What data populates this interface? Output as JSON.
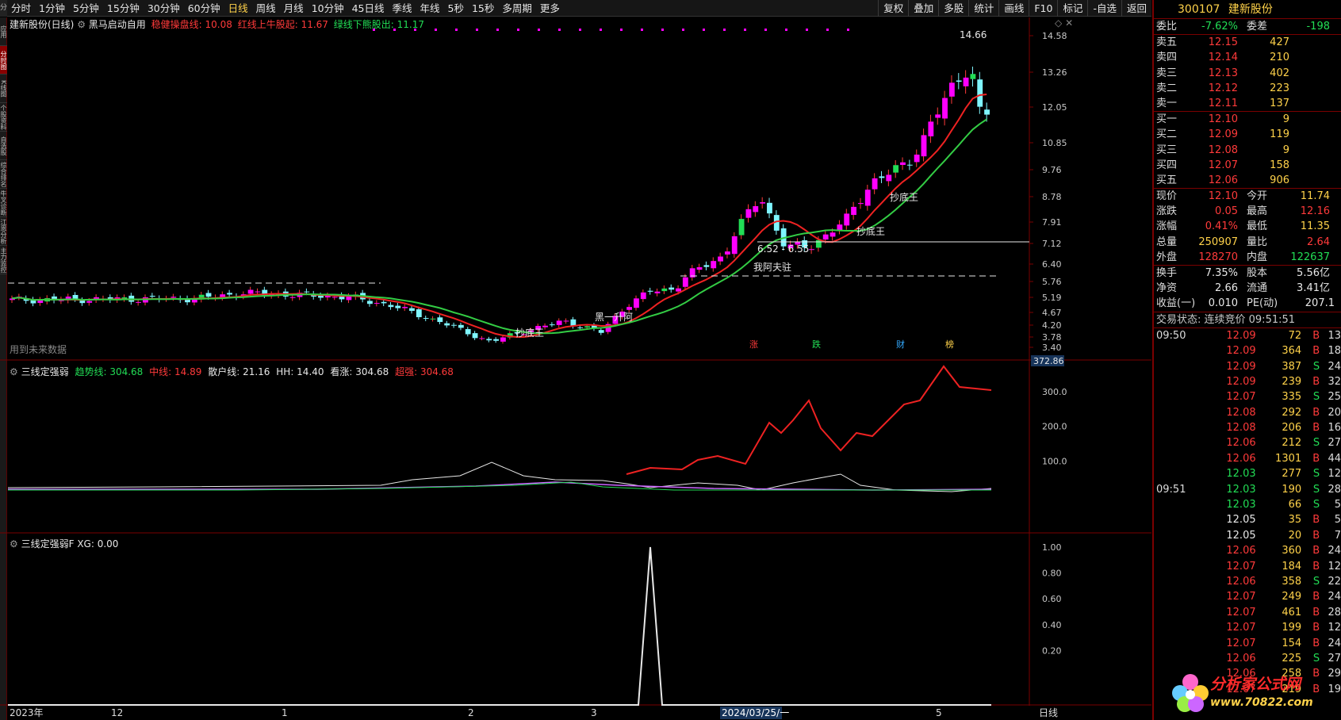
{
  "toolbar": {
    "left_tab": "分",
    "periods": [
      "分时",
      "1分钟",
      "5分钟",
      "15分钟",
      "30分钟",
      "60分钟",
      "日线",
      "周线",
      "月线",
      "10分钟",
      "45日线",
      "季线",
      "年线",
      "5秒",
      "15秒",
      "多周期",
      "更多"
    ],
    "tools": [
      "复权",
      "叠加",
      "多股",
      "统计",
      "画线",
      "F10",
      "标记",
      "-自选",
      "返回"
    ]
  },
  "sidebar": [
    "应用",
    "分时图",
    "K线图",
    "个股资料",
    "自选股",
    "综合排名",
    "牛叉诊断",
    "江恩分析",
    "主力监控"
  ],
  "main": {
    "title": "建新股份(日线)",
    "formula": "黑马启动自用",
    "ind1": {
      "label": "稳健操盘线",
      "value": "10.08"
    },
    "ind2": {
      "label": "红线上牛股起",
      "value": "11.67"
    },
    "ind3": {
      "label": "绿线下熊股出",
      "value": "11.17"
    },
    "future_note": "用到未来数据",
    "annotations": {
      "a1": "抄底王",
      "a2": "抄底王",
      "a3": "抄底王",
      "a4": "我阿夫驻",
      "a5": "黑一升阿",
      "peak": "14.66",
      "range": "6.52 - 6.55"
    },
    "event_tags": [
      "涨",
      "跌",
      "财",
      "榜"
    ],
    "y_ticks": [
      "14.58",
      "13.26",
      "12.05",
      "10.85",
      "9.76",
      "8.78",
      "7.91",
      "7.12",
      "6.40",
      "5.76",
      "5.19",
      "4.67",
      "4.20",
      "3.78",
      "3.40"
    ]
  },
  "pane2": {
    "name": "三线定强弱",
    "items": [
      {
        "k": "趋势线",
        "v": "304.68"
      },
      {
        "k": "中线",
        "v": "14.89"
      },
      {
        "k": "散户线",
        "v": "21.16"
      },
      {
        "k": "HH",
        "v": "14.40"
      },
      {
        "k": "看涨",
        "v": "304.68"
      },
      {
        "k": "超强",
        "v": "304.68"
      }
    ],
    "max": "372.86",
    "y_ticks": [
      "300.0",
      "200.0",
      "100.0"
    ]
  },
  "pane3": {
    "name": "三线定强弱F",
    "xg": "XG: 0.00",
    "y_ticks": [
      "1.00",
      "0.80",
      "0.60",
      "0.40",
      "0.20"
    ]
  },
  "xaxis": {
    "labels": [
      "2023年",
      "12",
      "1",
      "2",
      "3",
      "2024/03/25/一",
      "5"
    ],
    "period": "日线"
  },
  "quote": {
    "code": "300107",
    "name": "建新股份",
    "weibi": {
      "label": "委比",
      "value": "-7.62%",
      "label2": "委差",
      "value2": "-198"
    },
    "asks": [
      {
        "l": "卖五",
        "p": "12.15",
        "v": "427"
      },
      {
        "l": "卖四",
        "p": "12.14",
        "v": "210"
      },
      {
        "l": "卖三",
        "p": "12.13",
        "v": "402"
      },
      {
        "l": "卖二",
        "p": "12.12",
        "v": "223"
      },
      {
        "l": "卖一",
        "p": "12.11",
        "v": "137"
      }
    ],
    "bids": [
      {
        "l": "买一",
        "p": "12.10",
        "v": "9"
      },
      {
        "l": "买二",
        "p": "12.09",
        "v": "119"
      },
      {
        "l": "买三",
        "p": "12.08",
        "v": "9"
      },
      {
        "l": "买四",
        "p": "12.07",
        "v": "158"
      },
      {
        "l": "买五",
        "p": "12.06",
        "v": "906"
      }
    ],
    "stats": [
      {
        "a": "现价",
        "b": "12.10",
        "c": "今开",
        "d": "11.74",
        "bc": "up",
        "dc": "yl2"
      },
      {
        "a": "涨跌",
        "b": "0.05",
        "c": "最高",
        "d": "12.16",
        "bc": "up",
        "dc": "up"
      },
      {
        "a": "涨幅",
        "b": "0.41%",
        "c": "最低",
        "d": "11.35",
        "bc": "up",
        "dc": "yl2"
      },
      {
        "a": "总量",
        "b": "250907",
        "c": "量比",
        "d": "2.64",
        "bc": "yl2",
        "dc": "up"
      },
      {
        "a": "外盘",
        "b": "128270",
        "c": "内盘",
        "d": "122637",
        "bc": "up",
        "dc": "dn"
      }
    ],
    "stats2": [
      {
        "a": "换手",
        "b": "7.35%",
        "c": "股本",
        "d": "5.56亿"
      },
      {
        "a": "净资",
        "b": "2.66",
        "c": "流通",
        "d": "3.41亿"
      },
      {
        "a": "收益(一)",
        "b": "0.010",
        "c": "PE(动)",
        "d": "207.1"
      }
    ],
    "status": "交易状态: 连续竞价 09:51:51",
    "ticks": [
      {
        "t": "09:50",
        "p": "12.09",
        "v": "72",
        "s": "B",
        "n": "13"
      },
      {
        "t": "",
        "p": "12.09",
        "v": "364",
        "s": "B",
        "n": "18"
      },
      {
        "t": "",
        "p": "12.09",
        "v": "387",
        "s": "S",
        "n": "24"
      },
      {
        "t": "",
        "p": "12.09",
        "v": "239",
        "s": "B",
        "n": "32"
      },
      {
        "t": "",
        "p": "12.07",
        "v": "335",
        "s": "S",
        "n": "25"
      },
      {
        "t": "",
        "p": "12.08",
        "v": "292",
        "s": "B",
        "n": "20"
      },
      {
        "t": "",
        "p": "12.08",
        "v": "206",
        "s": "B",
        "n": "16"
      },
      {
        "t": "",
        "p": "12.06",
        "v": "212",
        "s": "S",
        "n": "27"
      },
      {
        "t": "",
        "p": "12.06",
        "v": "1301",
        "s": "B",
        "n": "44"
      },
      {
        "t": "",
        "p": "12.03",
        "v": "277",
        "s": "S",
        "n": "12"
      },
      {
        "t": "09:51",
        "p": "12.03",
        "v": "190",
        "s": "S",
        "n": "28"
      },
      {
        "t": "",
        "p": "12.03",
        "v": "66",
        "s": "S",
        "n": "5"
      },
      {
        "t": "",
        "p": "12.05",
        "v": "35",
        "s": "B",
        "n": "5"
      },
      {
        "t": "",
        "p": "12.05",
        "v": "20",
        "s": "B",
        "n": "7"
      },
      {
        "t": "",
        "p": "12.06",
        "v": "360",
        "s": "B",
        "n": "24"
      },
      {
        "t": "",
        "p": "12.07",
        "v": "184",
        "s": "B",
        "n": "12"
      },
      {
        "t": "",
        "p": "12.06",
        "v": "358",
        "s": "S",
        "n": "22"
      },
      {
        "t": "",
        "p": "12.07",
        "v": "249",
        "s": "B",
        "n": "24"
      },
      {
        "t": "",
        "p": "12.07",
        "v": "461",
        "s": "B",
        "n": "28"
      },
      {
        "t": "",
        "p": "12.07",
        "v": "199",
        "s": "B",
        "n": "12"
      },
      {
        "t": "",
        "p": "12.07",
        "v": "154",
        "s": "B",
        "n": "24"
      },
      {
        "t": "",
        "p": "12.06",
        "v": "225",
        "s": "S",
        "n": "27"
      },
      {
        "t": "",
        "p": "12.06",
        "v": "258",
        "s": "B",
        "n": "29"
      },
      {
        "t": "",
        "p": "12.07",
        "v": "219",
        "s": "B",
        "n": "19"
      }
    ]
  },
  "logo": {
    "text": "分析家公式网",
    "url": "www.70822.com"
  },
  "colors": {
    "up": "#ff3a3a",
    "down": "#22dd55",
    "accent": "#ffd24a",
    "border": "#7a0000",
    "bull_candle": "#ff00ff",
    "bear_candle": "#7ff6ff"
  }
}
